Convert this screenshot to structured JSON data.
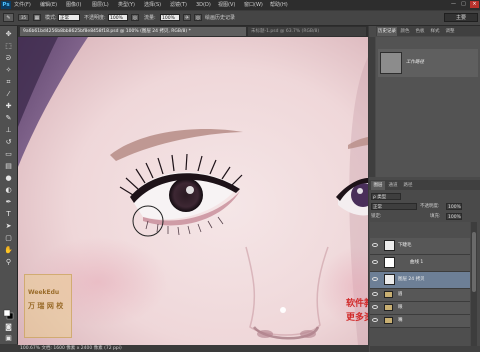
{
  "app": {
    "logo": "Ps"
  },
  "menubar": {
    "items": [
      "文件(F)",
      "编辑(E)",
      "图像(I)",
      "图层(L)",
      "类型(Y)",
      "选择(S)",
      "滤镜(T)",
      "3D(D)",
      "视图(V)",
      "窗口(W)",
      "帮助(H)"
    ],
    "window_buttons": {
      "minimize": "—",
      "restore": "□",
      "close": "×"
    }
  },
  "options": {
    "brush_size": "35",
    "mode_label": "模式:",
    "mode_value": "正常",
    "opacity_label": "不透明度:",
    "opacity_value": "100%",
    "flow_label": "流量:",
    "flow_value": "100%",
    "history_label": "绘画历史记录",
    "workspace": "主要"
  },
  "document": {
    "tab_active": "9a6b61bd4256b8bb8625bf8e8458f18.psd @ 100% (图层 24 拷贝, RGB/8) *",
    "tab_other": "未标题-1.psd @ 63.7% (RGB/8)",
    "status": "100.67%  文档: 1600 像素 x 2400 像素 (72 ppi)"
  },
  "history_panel": {
    "tabs": [
      "历史记录",
      "颜色",
      "色板",
      "样式",
      "调整"
    ],
    "item": "工作路径"
  },
  "layers_panel": {
    "tabs": [
      "图层",
      "通道",
      "路径"
    ],
    "filter_label": "ρ 类型",
    "blend_mode": "正常",
    "opacity_label": "不透明度:",
    "opacity_value": "100%",
    "lock_label": "锁定:",
    "fill_label": "填充:",
    "fill_value": "100%",
    "layers": [
      {
        "name": "下睫毛"
      },
      {
        "name": "曲线 1"
      },
      {
        "name": "图层 24 拷贝"
      },
      {
        "name": "眉"
      },
      {
        "name": "眼"
      },
      {
        "name": "嘴"
      }
    ]
  },
  "watermark": {
    "left_lines": [
      "WeekEdu",
      "万 瑞 网 校"
    ],
    "right_lines": [
      "软件教程",
      "更多资源"
    ]
  },
  "colors": {
    "accent": "#4fc3ff",
    "selected_layer": "#6d7f96",
    "close": "#b8322c"
  }
}
